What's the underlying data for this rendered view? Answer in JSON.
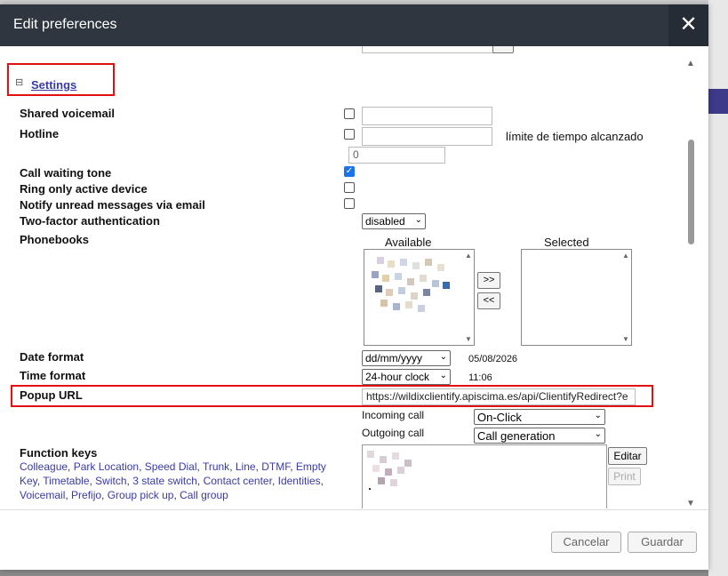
{
  "dialog": {
    "title": "Edit preferences",
    "close_glyph": "✕"
  },
  "settings": {
    "section_title": "Settings",
    "collapse_glyph": "⊟",
    "shared_voicemail": {
      "label": "Shared voicemail",
      "checked": false,
      "value": ""
    },
    "hotline": {
      "label": "Hotline",
      "checked": false,
      "value": "",
      "timeout_label": "límite de tiempo alcanzado",
      "timeout_value": "0"
    },
    "call_waiting_tone": {
      "label": "Call waiting tone",
      "checked": true
    },
    "ring_only_active_device": {
      "label": "Ring only active device",
      "checked": false
    },
    "notify_unread_email": {
      "label": "Notify unread messages via email",
      "checked": false
    },
    "two_factor": {
      "label": "Two-factor authentication",
      "selected": "disabled"
    },
    "phonebooks": {
      "label": "Phonebooks",
      "available_label": "Available",
      "selected_label": "Selected",
      "add_button": ">>",
      "remove_button": "<<"
    },
    "date_format": {
      "label": "Date format",
      "selected": "dd/mm/yyyy",
      "preview": "05/08/2026"
    },
    "time_format": {
      "label": "Time format",
      "selected": "24-hour clock",
      "preview": "11:06"
    },
    "popup_url": {
      "label": "Popup URL",
      "value": "https://wildixclientify.apiscima.es/api/ClientifyRedirect?e",
      "incoming_label": "Incoming call",
      "incoming_selected": "On-Click",
      "outgoing_label": "Outgoing call",
      "outgoing_selected": "Call generation"
    },
    "function_keys": {
      "label": "Function keys",
      "types": [
        "Colleague",
        "Park Location",
        "Speed Dial",
        "Trunk",
        "Line",
        "DTMF",
        "Empty Key",
        "Timetable",
        "Switch",
        "3 state switch",
        "Contact center",
        "Identities",
        "Voicemail",
        "Prefijo",
        "Group pick up",
        "Call group"
      ],
      "edit_button": "Editar",
      "print_button": "Print"
    }
  },
  "footer": {
    "cancel_label": "Cancelar",
    "save_label": "Guardar"
  },
  "colors": {
    "titlebar": "#2f3640",
    "link": "#3a3aa6",
    "highlight": "#e01010",
    "checkbox_checked": "#1a73e8"
  }
}
